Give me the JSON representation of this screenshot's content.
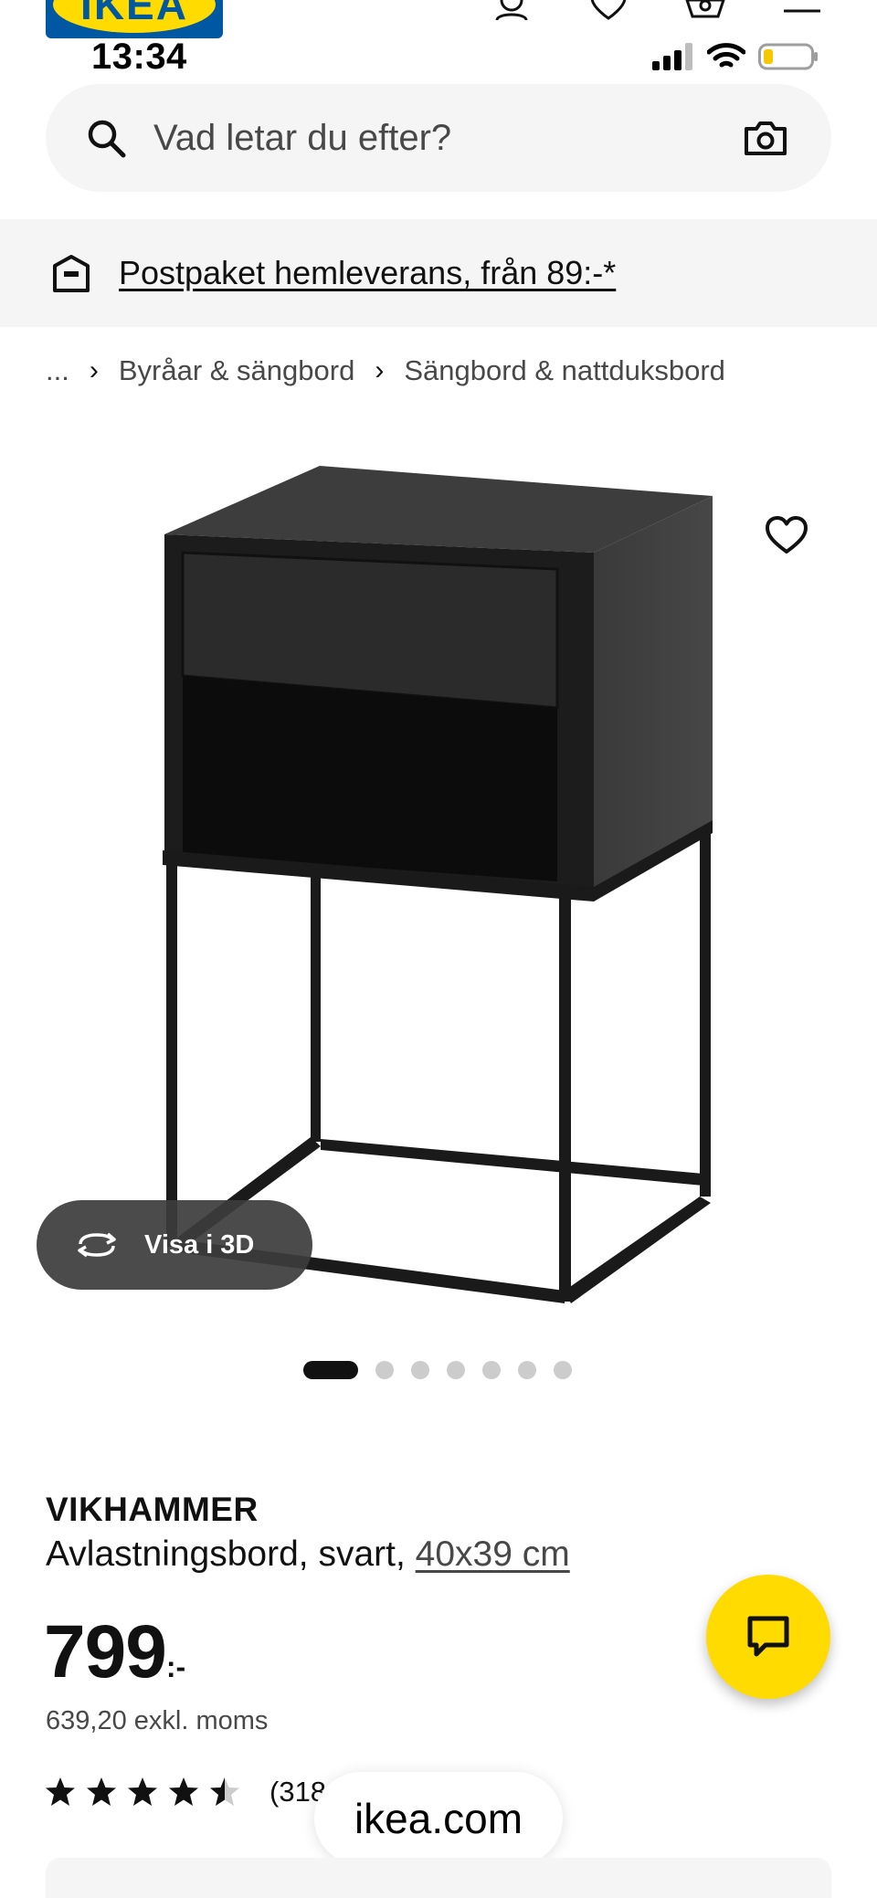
{
  "brand": {
    "logo_text": "IKEA"
  },
  "status_bar": {
    "time": "13:34"
  },
  "header_icons": [
    "person-icon",
    "heart-icon",
    "basket-icon",
    "menu-icon"
  ],
  "search": {
    "placeholder": "Vad letar du efter?"
  },
  "banner": {
    "text": "Postpaket hemleverans, från 89:-*"
  },
  "breadcrumb": {
    "ellipsis": "...",
    "items": [
      "Byråar & sängbord",
      "Sängbord & nattduksbord"
    ]
  },
  "gallery": {
    "view_3d_label": "Visa i 3D",
    "image_count": 7,
    "active_index": 0
  },
  "product": {
    "name": "VIKHAMMER",
    "description": "Avlastningsbord, svart,",
    "size": "40x39 cm",
    "price_integer": "799",
    "price_suffix": ":-",
    "price_excl_vat": "639,20 exkl. moms",
    "rating_value": 4.5,
    "rating_max": 5,
    "review_count": "(318"
  },
  "browser": {
    "url": "ikea.com"
  },
  "colors": {
    "ikea_blue": "#0058a3",
    "ikea_yellow": "#ffdb00",
    "surface_gray": "#f5f5f5",
    "text_dark": "#111111"
  }
}
